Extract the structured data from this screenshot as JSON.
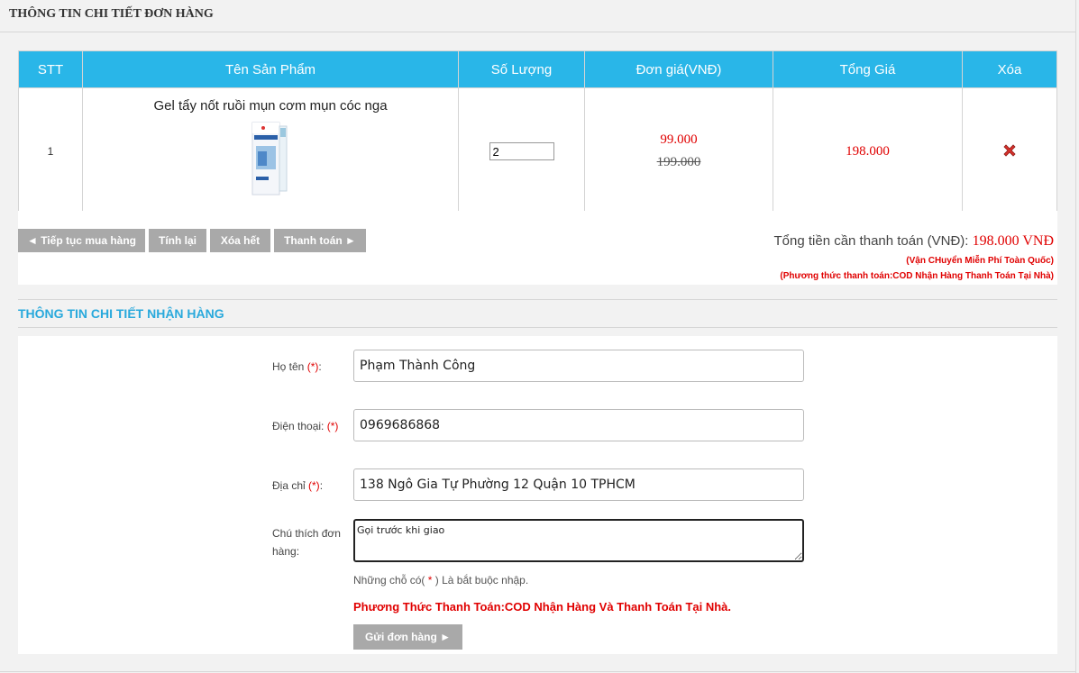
{
  "order_section": {
    "title": "THÔNG TIN CHI TIẾT ĐƠN HÀNG"
  },
  "cart_table": {
    "headers": [
      "STT",
      "Tên Sản Phẩm",
      "Số Lượng",
      "Đơn giá(VNĐ)",
      "Tổng Giá",
      "Xóa"
    ],
    "rows": [
      {
        "stt": "1",
        "product_name": "Gel tẩy nốt ruồi mụn cơm mụn cóc nga",
        "product_image": "product-box-image",
        "quantity": "2",
        "price_sale": "99.000",
        "price_original": "199.000",
        "total": "198.000",
        "delete_icon": "red-x-icon"
      }
    ]
  },
  "actions": {
    "continue_label": "◄ Tiếp tục mua hàng",
    "recalc_label": "Tính lại",
    "clear_label": "Xóa hết",
    "checkout_label": "Thanh toán ►"
  },
  "summary": {
    "total_label": "Tổng tiền cần thanh toán (VNĐ): ",
    "total_amount": "198.000 VNĐ",
    "shipping_note": "(Vận CHuyển Miễn Phí Toàn Quốc)",
    "payment_note": "(Phương thức thanh toán:COD Nhận Hàng Thanh Toán Tại Nhà)"
  },
  "shipping_section": {
    "title": "THÔNG TIN CHI TIẾT NHẬN HÀNG",
    "fields": {
      "name_label": "Họ tên ",
      "name_value": "Phạm Thành Công",
      "phone_label": "Điện thoại: ",
      "phone_value": "0969686868",
      "address_label": "Địa chỉ ",
      "address_value": "138 Ngô Gia Tự Phường 12 Quận 10 TPHCM",
      "note_label_line1": "Chú thích đơn",
      "note_label_line2": "hàng:",
      "note_value": "Gọi trước khi giao",
      "required_mark": "(*)"
    },
    "required_hint_before": "Những chỗ có( ",
    "required_hint_star": "*",
    "required_hint_after": " ) Là bắt buộc nhập.",
    "payment_method": "Phương Thức Thanh Toán:COD Nhận Hàng Và Thanh Toán Tại Nhà.",
    "submit_label": "Gửi đơn hàng ►"
  },
  "colors": {
    "header_blue": "#29b6e8",
    "section_title_blue": "#29a9dc",
    "price_red": "#e00000",
    "button_gray": "#a9a9a9"
  }
}
